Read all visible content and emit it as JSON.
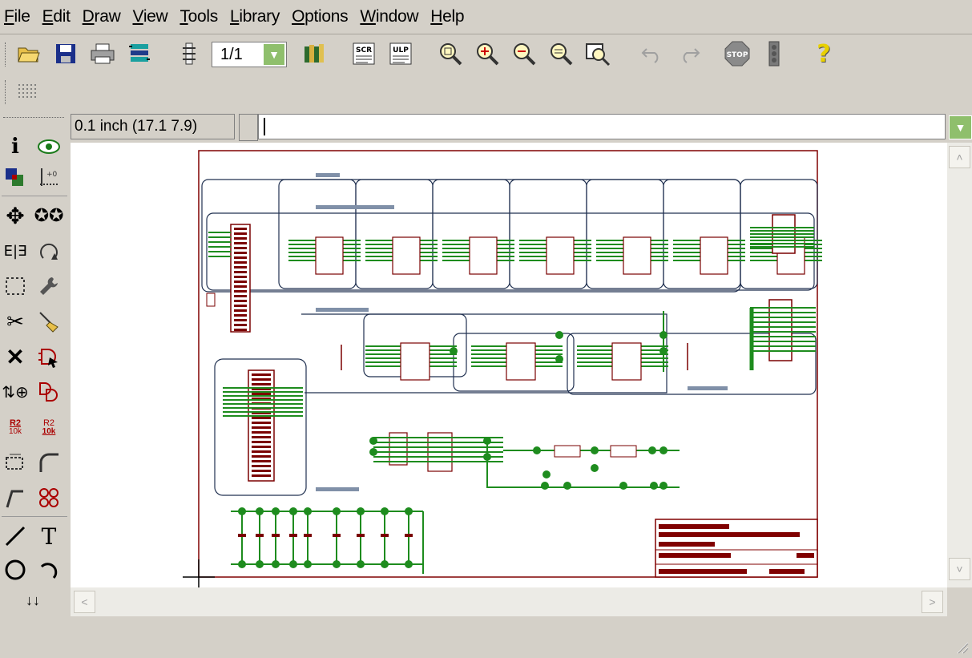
{
  "menu": [
    {
      "u": "F",
      "rest": "ile"
    },
    {
      "u": "E",
      "rest": "dit"
    },
    {
      "u": "D",
      "rest": "raw"
    },
    {
      "u": "V",
      "rest": "iew"
    },
    {
      "u": "T",
      "rest": "ools"
    },
    {
      "u": "L",
      "rest": "ibrary"
    },
    {
      "u": "O",
      "rest": "ptions"
    },
    {
      "u": "W",
      "rest": "indow"
    },
    {
      "u": "H",
      "rest": "elp"
    }
  ],
  "toolbar": {
    "sheet_value": "1/1",
    "scr_label": "SCR",
    "ulp_label": "ULP",
    "stop_label": "STOP",
    "help_glyph": "?"
  },
  "coordinates": "0.1 inch (17.1 7.9)",
  "command_line": "",
  "left_tools": {
    "r2_label": "R2",
    "val_label": "10k",
    "text_glyph": "T"
  },
  "colors": {
    "net": "#1e8c1e",
    "bus": "#203050",
    "part": "#7a0000",
    "frame": "#800000",
    "dropdown": "#8fbf6c"
  }
}
